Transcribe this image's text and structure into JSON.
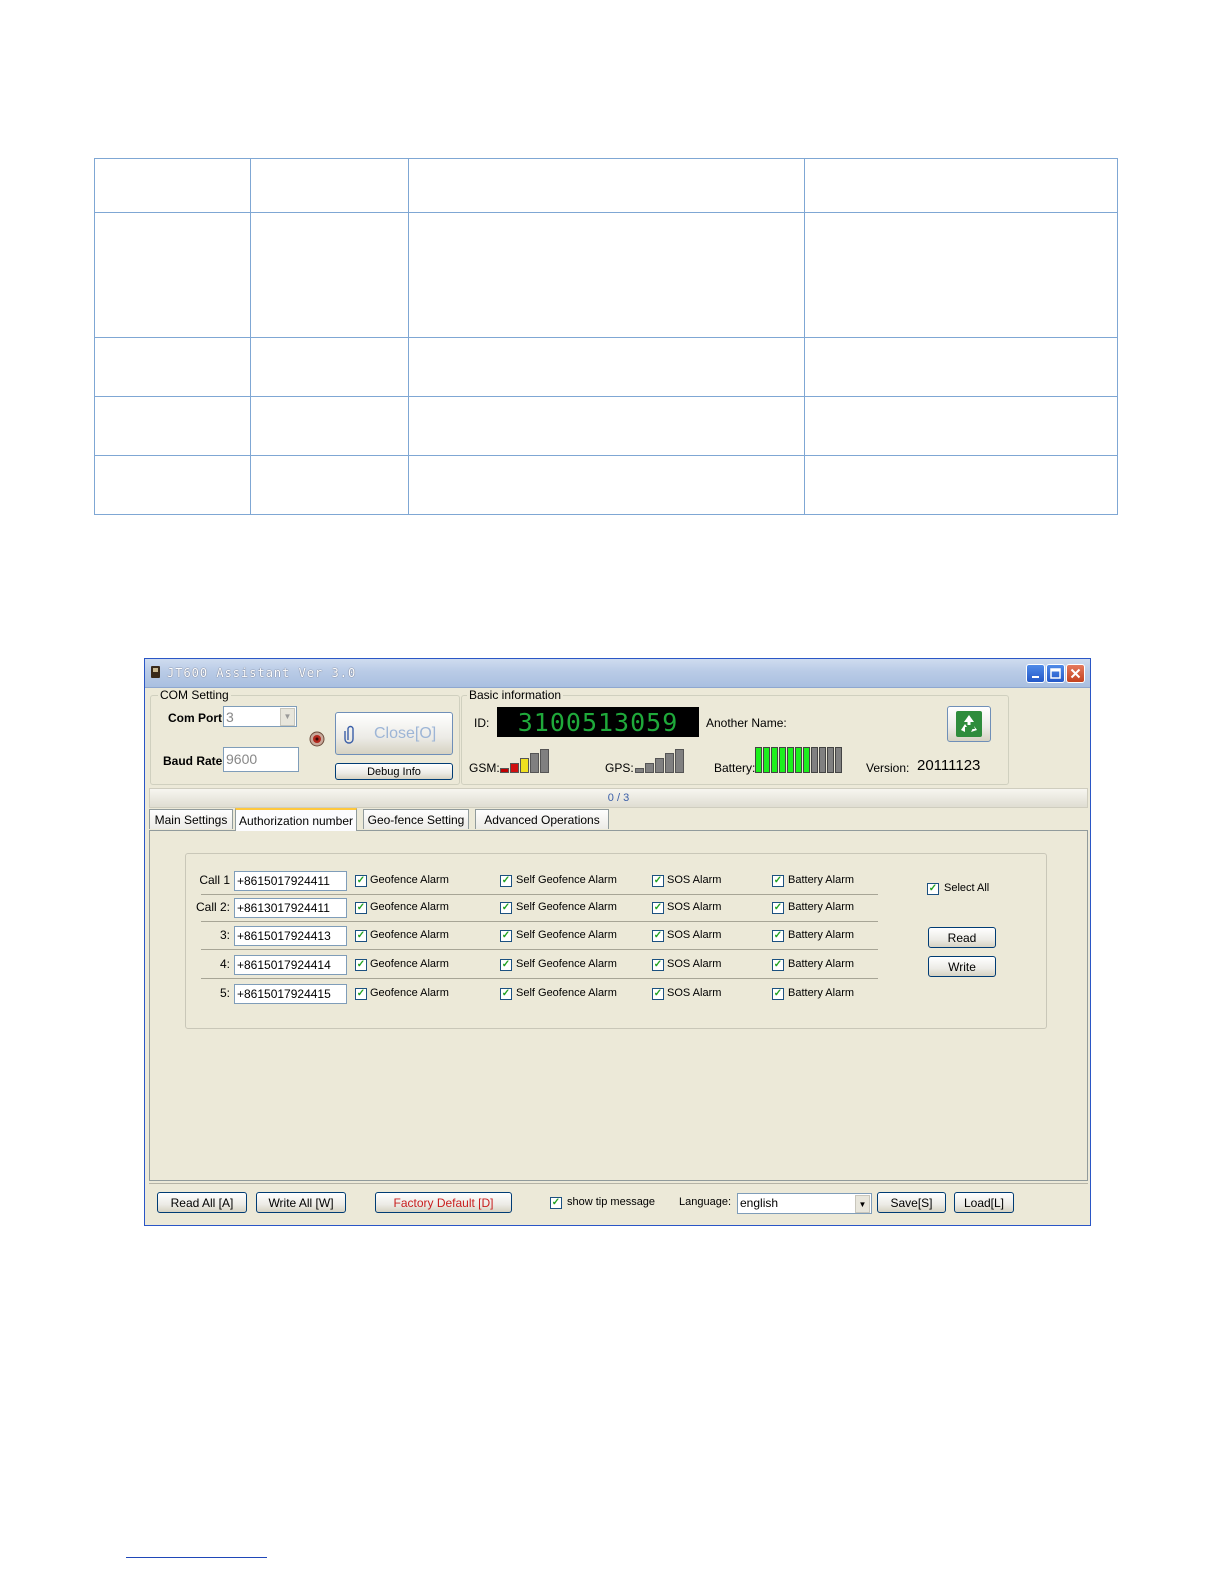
{
  "window": {
    "title": "JT600 Assistant Ver 3.0",
    "controls": [
      "minimize",
      "maximize",
      "close"
    ]
  },
  "com_setting": {
    "legend": "COM Setting",
    "com_port_label": "Com Port",
    "com_port_value": "3",
    "baud_rate_label": "Baud Rate",
    "baud_rate_value": "9600",
    "close_button": "Close[O]",
    "debug_button": "Debug Info"
  },
  "basic_info": {
    "legend": "Basic information",
    "id_label": "ID:",
    "id_value": "3100513059",
    "another_name_label": "Another Name:",
    "gsm_label": "GSM:",
    "gps_label": "GPS:",
    "battery_label": "Battery:",
    "version_label": "Version:",
    "version_value": "20111123",
    "battery_level_segments": 7,
    "battery_total_segments": 11
  },
  "progress_text": "0 / 3",
  "tabs": [
    {
      "label": "Main Settings"
    },
    {
      "label": "Authorization number",
      "active": true
    },
    {
      "label": "Geo-fence Setting"
    },
    {
      "label": "Advanced Operations"
    }
  ],
  "auth_rows": [
    {
      "label": "Call 1",
      "number": "+8615017924411"
    },
    {
      "label": "Call 2:",
      "number": "+8613017924411"
    },
    {
      "label": "3:",
      "number": "+8615017924413"
    },
    {
      "label": "4:",
      "number": "+8615017924414"
    },
    {
      "label": "5:",
      "number": "+8615017924415"
    }
  ],
  "alarm_labels": {
    "geofence": "Geofence Alarm",
    "self_geofence": "Self Geofence Alarm",
    "sos": "SOS Alarm",
    "battery": "Battery Alarm"
  },
  "checkmark": "✓",
  "side_controls": {
    "select_all": "Select All",
    "read": "Read",
    "write": "Write"
  },
  "bottom_bar": {
    "read_all": "Read All [A]",
    "write_all": "Write All [W]",
    "factory_default": "Factory Default [D]",
    "show_tip": "show tip message",
    "language_label": "Language:",
    "language_value": "english",
    "save": "Save[S]",
    "load": "Load[L]"
  },
  "colors": {
    "title_bar": "#b9cbe6",
    "window_bg": "#ece9d8",
    "id_display_bg": "#000000",
    "id_display_fg": "#1fa93a",
    "battery_on": "#1cf01c",
    "battery_off": "#808080",
    "factory_default_text": "#c81e1e",
    "table_border": "#7fa7d4"
  }
}
